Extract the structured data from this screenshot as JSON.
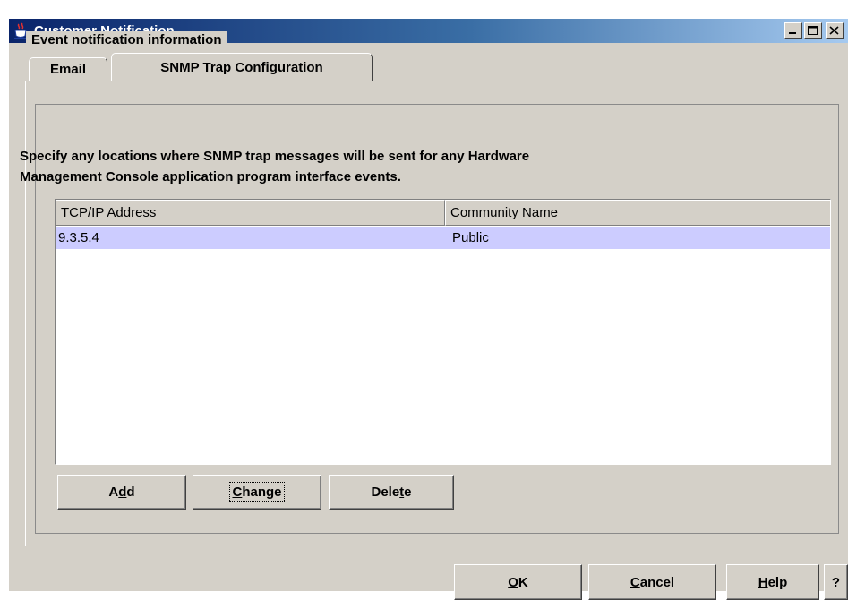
{
  "window": {
    "title": "Customer Notification",
    "icon": "java-cup-icon"
  },
  "tabs": [
    {
      "label": "Email",
      "active": false
    },
    {
      "label": "SNMP Trap Configuration",
      "active": true
    }
  ],
  "group": {
    "legend": "Event notification information",
    "description_line1": "Specify any locations where SNMP trap messages will be sent for any Hardware",
    "description_line2": "Management Console application program interface events."
  },
  "table": {
    "columns": [
      "TCP/IP Address",
      "Community Name"
    ],
    "rows": [
      {
        "ip": "9.3.5.4",
        "community": "Public",
        "selected": true
      }
    ],
    "selection_color": "#ccccff"
  },
  "actions": {
    "add": {
      "pre": "A",
      "mnemonic": "d",
      "post": "d"
    },
    "change": {
      "pre": "",
      "mnemonic": "C",
      "post": "hange"
    },
    "delete": {
      "pre": "Dele",
      "mnemonic": "t",
      "post": "e"
    }
  },
  "footer": {
    "ok": {
      "pre": "",
      "mnemonic": "O",
      "post": "K"
    },
    "cancel": {
      "pre": "",
      "mnemonic": "C",
      "post": "ancel"
    },
    "help": {
      "pre": "",
      "mnemonic": "H",
      "post": "elp"
    },
    "question": "?"
  },
  "colors": {
    "title_bar_start": "#0a246a",
    "title_bar_end": "#a6caf0",
    "face": "#d4d0c8"
  }
}
